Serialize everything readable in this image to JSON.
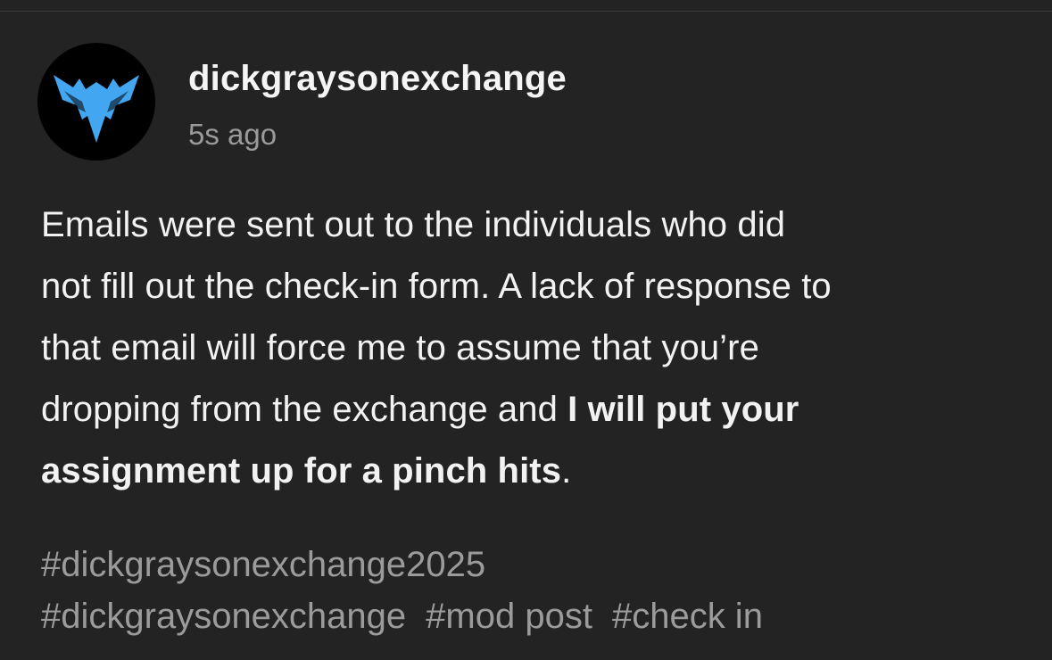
{
  "post": {
    "author": {
      "username": "dickgraysonexchange",
      "avatar_icon": "nightwing-logo-icon",
      "avatar_color": "#43A6F0"
    },
    "timestamp": "5s ago",
    "body": {
      "line1": "Emails were sent out to the individuals who did",
      "line2": "not fill out the check-in form. A lack of response to",
      "line3": "that email will force me to assume that you’re",
      "line4_regular": "dropping from the exchange and ",
      "line4_bold": "I will put your",
      "line5_bold": "assignment up for a pinch hits",
      "line5_regular": "."
    },
    "tags": [
      "#dickgraysonexchange2025",
      "#dickgraysonexchange",
      "#mod post",
      "#check in"
    ]
  }
}
